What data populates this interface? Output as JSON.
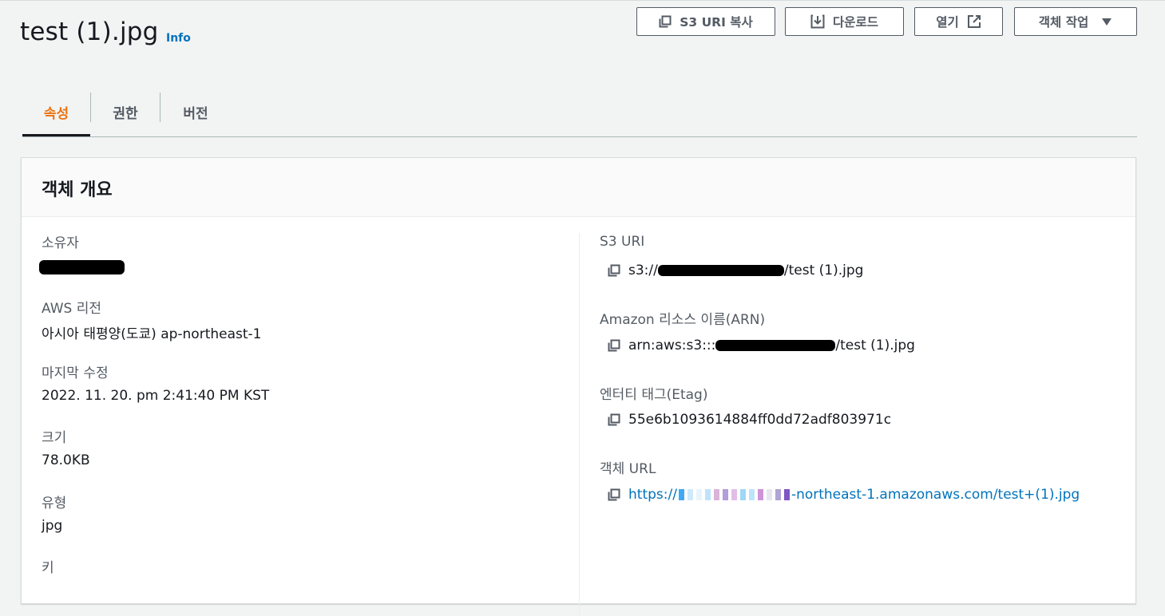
{
  "header": {
    "title": "test (1).jpg",
    "info_label": "Info",
    "buttons": {
      "copy_uri": "S3 URI 복사",
      "download": "다운로드",
      "open": "열기",
      "actions": "객체 작업"
    }
  },
  "tabs": [
    {
      "label": "속성",
      "active": true
    },
    {
      "label": "권한",
      "active": false
    },
    {
      "label": "버전",
      "active": false
    }
  ],
  "panel": {
    "title": "객체 개요",
    "left": {
      "owner_label": "소유자",
      "region_label": "AWS 리전",
      "region_value": "아시아 태평양(도쿄) ap-northeast-1",
      "modified_label": "마지막 수정",
      "modified_value": "2022. 11. 20. pm 2:41:40 PM KST",
      "size_label": "크기",
      "size_value": "78.0KB",
      "type_label": "유형",
      "type_value": "jpg",
      "key_label": "키"
    },
    "right": {
      "uri_label": "S3 URI",
      "uri_prefix": "s3://",
      "uri_suffix": "/test (1).jpg",
      "arn_label": "Amazon 리소스 이름(ARN)",
      "arn_prefix": "arn:aws:s3:::",
      "arn_suffix": "/test (1).jpg",
      "etag_label": "엔터티 태그(Etag)",
      "etag_value": "55e6b1093614884ff0dd72adf803971c",
      "url_label": "객체 URL",
      "url_prefix": "https://",
      "url_suffix": "-northeast-1.amazonaws.com/test+(1).jpg"
    }
  },
  "colors": {
    "accent": "#ec7211",
    "link": "#0073bb",
    "text": "#16191f",
    "muted": "#545b64"
  }
}
